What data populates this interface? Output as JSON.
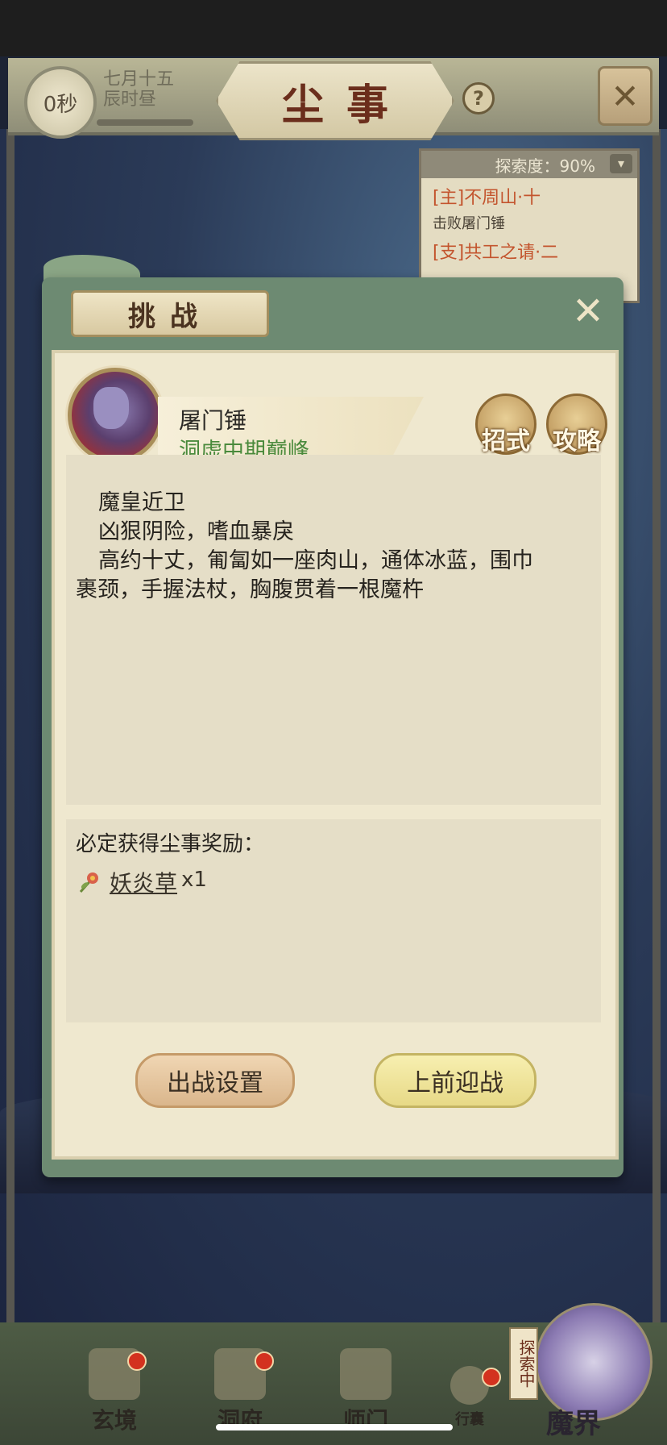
{
  "header": {
    "timer": "0秒",
    "date_line1": "七月十五",
    "date_line2": "辰时昼",
    "title": "尘事",
    "help": "?"
  },
  "quest_panel": {
    "explore_label": "探索度：90%",
    "items": [
      {
        "name": "[主]不周山·十",
        "desc": "击败屠门锤"
      },
      {
        "name": "[支]共工之请·二",
        "desc": ""
      }
    ]
  },
  "dialog": {
    "title": "挑战",
    "boss": {
      "name": "屠门锤",
      "rank": "洞虚中期巅峰"
    },
    "buttons": {
      "moves": "招式",
      "guide": "攻略",
      "setup": "出战设置",
      "fight": "上前迎战"
    },
    "description": [
      "魔皇近卫",
      "凶狠阴险，嗜血暴戾",
      "高约十丈，匍匐如一座肉山，通体冰蓝，围巾",
      "裹颈，手握法杖，胸腹贯着一根魔杵"
    ],
    "reward": {
      "title": "必定获得尘事奖励：",
      "item_name": "妖炎草",
      "item_count": "x1"
    }
  },
  "nav": {
    "items": [
      "玄境",
      "洞府",
      "师门",
      "行囊"
    ],
    "explore_tag": "探索中",
    "current": "魔界"
  },
  "colors": {
    "dialog_frame": "#6d8a72",
    "parchment": "#efe8cf",
    "rank_green": "#4a8a3c",
    "quest_red": "#c3542d"
  }
}
